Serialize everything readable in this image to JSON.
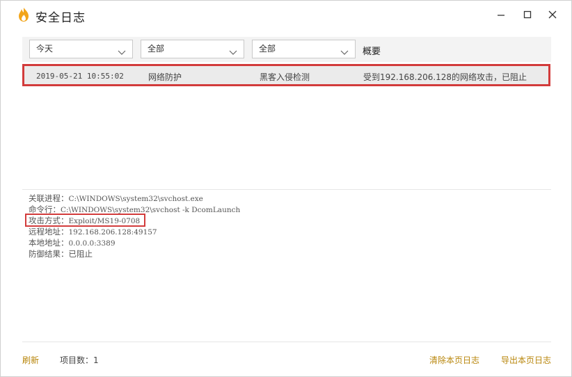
{
  "window": {
    "title": "安全日志"
  },
  "filters": {
    "time": "今天",
    "module": "全部",
    "type": "全部",
    "summary_header": "概要"
  },
  "log_rows": [
    {
      "time": "2019-05-21 10:55:02",
      "module": "网络防护",
      "type": "黑客入侵检测",
      "summary": "受到192.168.206.128的网络攻击，已阻止"
    }
  ],
  "details": {
    "process_label": "关联进程：",
    "process_value": "C:\\WINDOWS\\system32\\svchost.exe",
    "cmd_label": "命令行：",
    "cmd_value": "C:\\WINDOWS\\system32\\svchost -k DcomLaunch",
    "attack_label": "攻击方式：",
    "attack_value": "Exploit/MS19-0708",
    "remote_label": "远程地址：",
    "remote_value": "192.168.206.128:49157",
    "local_label": "本地地址：",
    "local_value": "0.0.0.0:3389",
    "result_label": "防御结果：",
    "result_value": "已阻止"
  },
  "footer": {
    "refresh_label": "刷新",
    "count_label": "项目数：1",
    "clear_label": "清除本页日志",
    "export_label": "导出本页日志"
  },
  "colors": {
    "highlight_border": "#d23b3b",
    "link": "#b8860b",
    "icon_flame": "#f2a51a"
  },
  "icons": [
    "flame-logo-icon",
    "minimize-icon",
    "maximize-icon",
    "close-icon",
    "chevron-down-icon"
  ]
}
